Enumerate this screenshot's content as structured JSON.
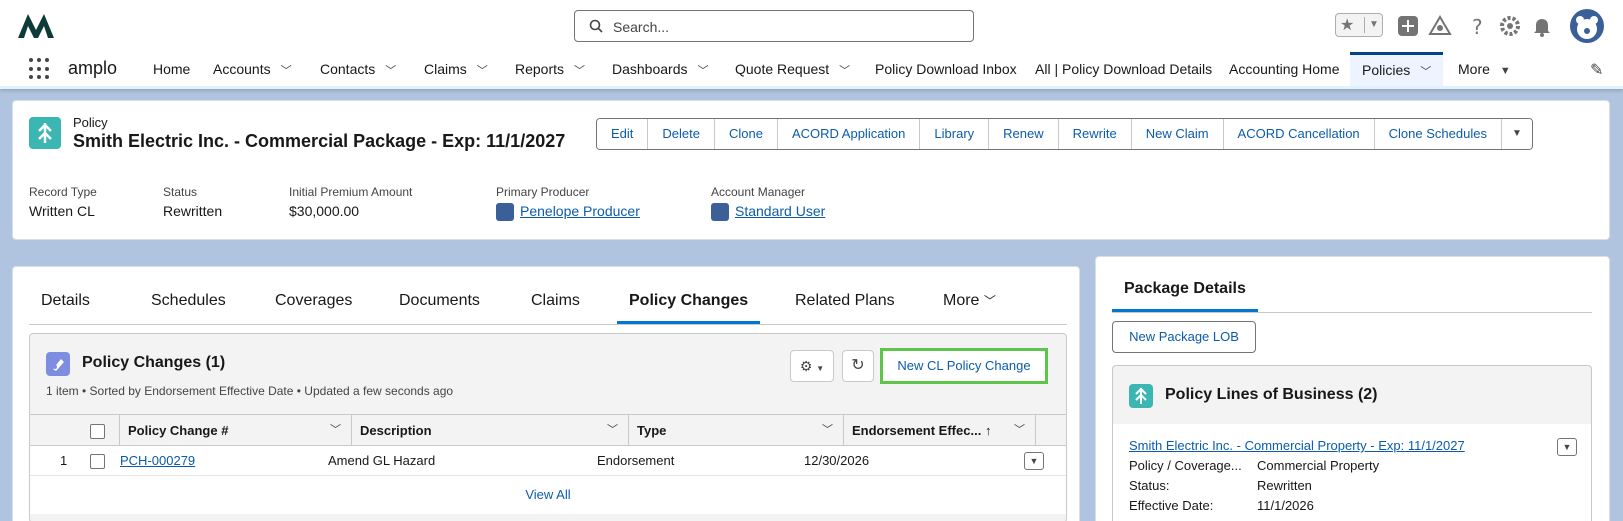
{
  "topbar": {
    "search_placeholder": "Search...",
    "icons": [
      "logo-icon",
      "search-icon",
      "star-icon",
      "chevron-down-icon",
      "plus-icon",
      "trailhead-icon",
      "help-icon",
      "gear-icon",
      "bell-icon",
      "avatar-icon"
    ]
  },
  "nav": {
    "app_name": "amplo",
    "items": [
      {
        "label": "Home",
        "has_menu": false
      },
      {
        "label": "Accounts",
        "has_menu": true
      },
      {
        "label": "Contacts",
        "has_menu": true
      },
      {
        "label": "Claims",
        "has_menu": true
      },
      {
        "label": "Reports",
        "has_menu": true
      },
      {
        "label": "Dashboards",
        "has_menu": true
      },
      {
        "label": "Quote Request",
        "has_menu": true
      },
      {
        "label": "Policy Download Inbox",
        "has_menu": false
      },
      {
        "label": "All | Policy Download Details",
        "has_menu": false
      },
      {
        "label": "Accounting Home",
        "has_menu": false
      },
      {
        "label": "Policies",
        "has_menu": true,
        "active": true
      },
      {
        "label": "More",
        "has_menu": true
      }
    ]
  },
  "record": {
    "object_type": "Policy",
    "title": "Smith Electric Inc. - Commercial Package - Exp: 11/1/2027",
    "actions": [
      "Edit",
      "Delete",
      "Clone",
      "ACORD Application",
      "Library",
      "Renew",
      "Rewrite",
      "New Claim",
      "ACORD Cancellation",
      "Clone Schedules"
    ],
    "fields": [
      {
        "label": "Record Type",
        "value": "Written CL"
      },
      {
        "label": "Status",
        "value": "Rewritten"
      },
      {
        "label": "Initial Premium Amount",
        "value": "$30,000.00"
      },
      {
        "label": "Primary Producer",
        "value": "Penelope Producer",
        "link": true
      },
      {
        "label": "Account Manager",
        "value": "Standard User",
        "link": true
      }
    ]
  },
  "tabs": {
    "items": [
      "Details",
      "Schedules",
      "Coverages",
      "Documents",
      "Claims",
      "Policy Changes",
      "Related Plans",
      "More"
    ],
    "active": "Policy Changes"
  },
  "related_list": {
    "title": "Policy Changes (1)",
    "subtitle": "1 item • Sorted by Endorsement Effective Date • Updated a few seconds ago",
    "new_button": "New CL Policy Change",
    "columns": [
      "Policy Change #",
      "Description",
      "Type",
      "Endorsement Effec..."
    ],
    "rows": [
      {
        "num": "1",
        "policy_change": "PCH-000279",
        "description": "Amend GL Hazard",
        "type": "Endorsement",
        "date": "12/30/2026"
      }
    ],
    "view_all": "View All"
  },
  "side": {
    "tab": "Package Details",
    "new_lob_button": "New Package LOB",
    "lob_title": "Policy Lines of Business (2)",
    "lob_item": {
      "link": "Smith Electric Inc. - Commercial Property - Exp: 11/1/2027",
      "fields": [
        {
          "label": "Policy / Coverage...",
          "value": "Commercial Property"
        },
        {
          "label": "Status:",
          "value": "Rewritten"
        },
        {
          "label": "Effective Date:",
          "value": "11/1/2026"
        }
      ]
    }
  }
}
